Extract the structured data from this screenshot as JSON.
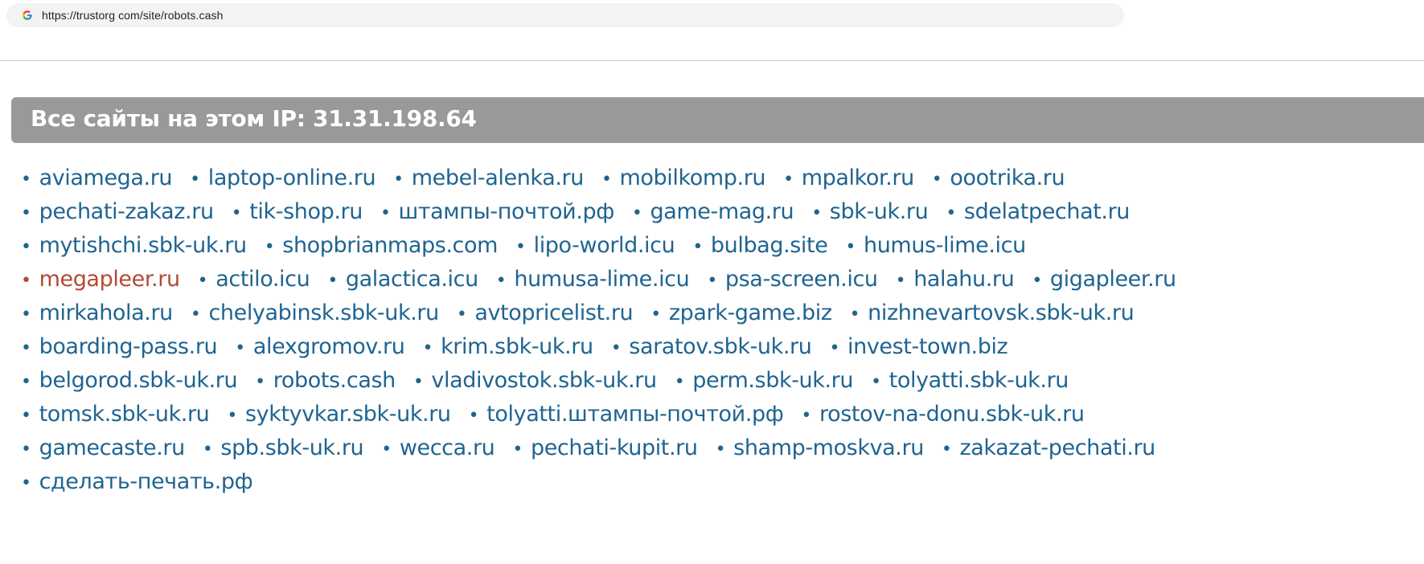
{
  "browser": {
    "url": "https://trustorg com/site/robots.cash",
    "favicon": "google-g-icon"
  },
  "section": {
    "title": "Все сайты на этом IP: 31.31.198.64"
  },
  "colors": {
    "link": "#1f6491",
    "visited_link": "#b34a32",
    "header_bg": "#999999"
  },
  "bullet": "•",
  "site_rows": [
    [
      {
        "label": "aviamega.ru"
      },
      {
        "label": "laptop-online.ru"
      },
      {
        "label": "mebel-alenka.ru"
      },
      {
        "label": "mobilkomp.ru"
      },
      {
        "label": "mpalkor.ru"
      },
      {
        "label": "oootrika.ru"
      }
    ],
    [
      {
        "label": "pechati-zakaz.ru"
      },
      {
        "label": "tik-shop.ru"
      },
      {
        "label": "штампы-почтой.рф"
      },
      {
        "label": "game-mag.ru"
      },
      {
        "label": "sbk-uk.ru"
      },
      {
        "label": "sdelatpechat.ru"
      }
    ],
    [
      {
        "label": "mytishchi.sbk-uk.ru"
      },
      {
        "label": "shopbrianmaps.com"
      },
      {
        "label": "lipo-world.icu"
      },
      {
        "label": "bulbag.site"
      },
      {
        "label": "humus-lime.icu"
      }
    ],
    [
      {
        "label": "megapleer.ru",
        "visited": true
      },
      {
        "label": "actilo.icu"
      },
      {
        "label": "galactica.icu"
      },
      {
        "label": "humusa-lime.icu"
      },
      {
        "label": "psa-screen.icu"
      },
      {
        "label": "halahu.ru"
      },
      {
        "label": "gigapleer.ru"
      }
    ],
    [
      {
        "label": "mirkahola.ru"
      },
      {
        "label": "chelyabinsk.sbk-uk.ru"
      },
      {
        "label": "avtopricelist.ru"
      },
      {
        "label": "zpark-game.biz"
      },
      {
        "label": "nizhnevartovsk.sbk-uk.ru"
      }
    ],
    [
      {
        "label": "boarding-pass.ru"
      },
      {
        "label": "alexgromov.ru"
      },
      {
        "label": "krim.sbk-uk.ru"
      },
      {
        "label": "saratov.sbk-uk.ru"
      },
      {
        "label": "invest-town.biz"
      }
    ],
    [
      {
        "label": "belgorod.sbk-uk.ru"
      },
      {
        "label": "robots.cash"
      },
      {
        "label": "vladivostok.sbk-uk.ru"
      },
      {
        "label": "perm.sbk-uk.ru"
      },
      {
        "label": "tolyatti.sbk-uk.ru"
      }
    ],
    [
      {
        "label": "tomsk.sbk-uk.ru"
      },
      {
        "label": "syktyvkar.sbk-uk.ru"
      },
      {
        "label": "tolyatti.штампы-почтой.рф"
      },
      {
        "label": "rostov-na-donu.sbk-uk.ru"
      }
    ],
    [
      {
        "label": "gamecaste.ru"
      },
      {
        "label": "spb.sbk-uk.ru"
      },
      {
        "label": "wecca.ru"
      },
      {
        "label": "pechati-kupit.ru"
      },
      {
        "label": "shamp-moskva.ru"
      },
      {
        "label": "zakazat-pechati.ru"
      }
    ],
    [
      {
        "label": "сделать-печать.рф"
      }
    ]
  ]
}
